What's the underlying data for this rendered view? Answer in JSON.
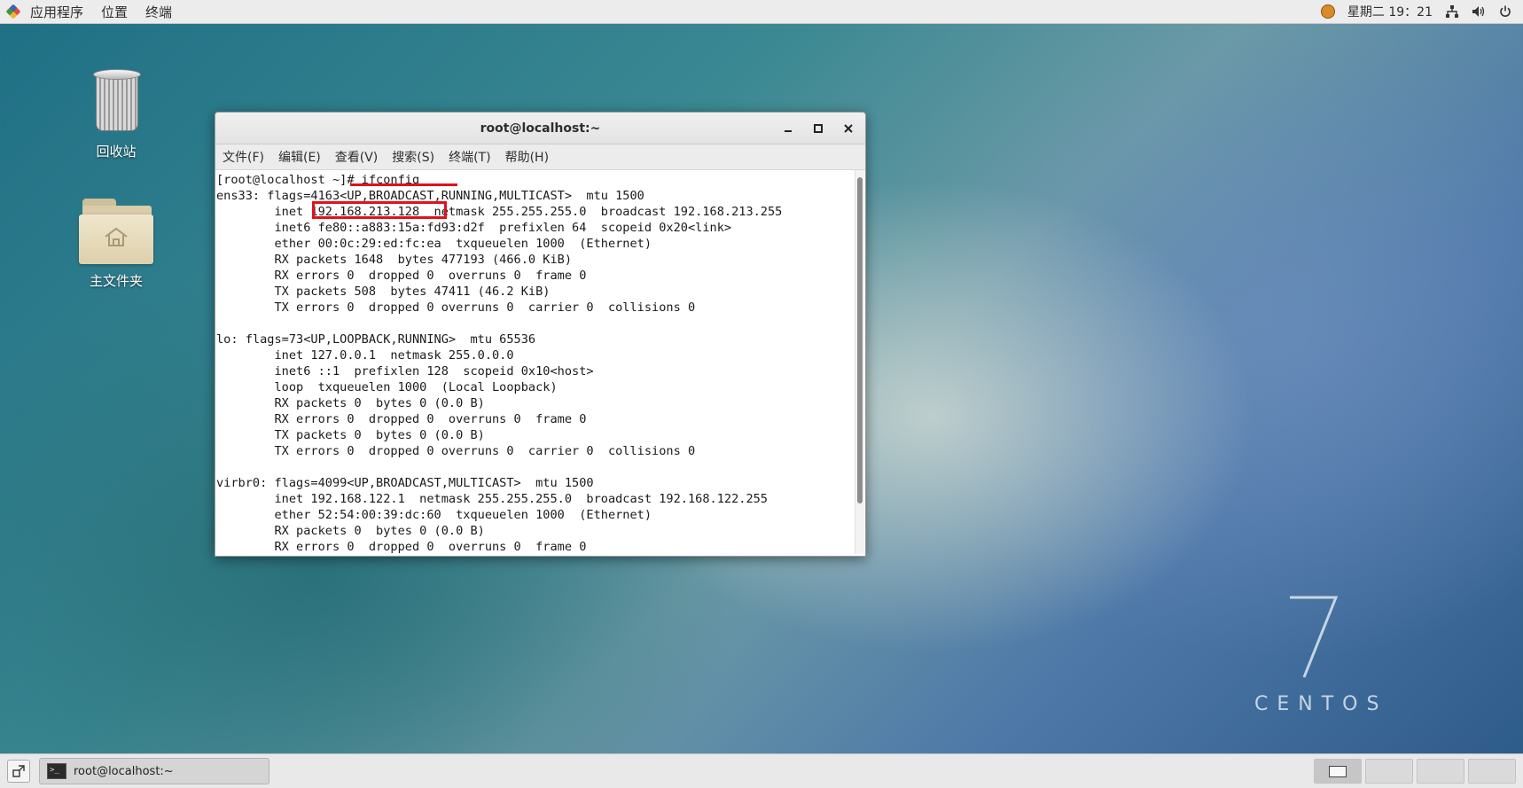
{
  "topbar": {
    "menu": [
      "应用程序",
      "位置",
      "终端"
    ],
    "clock": "星期二 19：21"
  },
  "desktop": {
    "icons": [
      {
        "label": "回收站",
        "icon": "trash-icon"
      },
      {
        "label": "主文件夹",
        "icon": "home-folder-icon"
      }
    ],
    "watermark": {
      "number": "7",
      "word": "CENTOS"
    }
  },
  "terminal": {
    "title": "root@localhost:~",
    "menu": [
      "文件(F)",
      "编辑(E)",
      "查看(V)",
      "搜索(S)",
      "终端(T)",
      "帮助(H)"
    ],
    "lines": [
      "[root@localhost ~]# ifconfig",
      "ens33: flags=4163<UP,BROADCAST,RUNNING,MULTICAST>  mtu 1500",
      "        inet 192.168.213.128  netmask 255.255.255.0  broadcast 192.168.213.255",
      "        inet6 fe80::a883:15a:fd93:d2f  prefixlen 64  scopeid 0x20<link>",
      "        ether 00:0c:29:ed:fc:ea  txqueuelen 1000  (Ethernet)",
      "        RX packets 1648  bytes 477193 (466.0 KiB)",
      "        RX errors 0  dropped 0  overruns 0  frame 0",
      "        TX packets 508  bytes 47411 (46.2 KiB)",
      "        TX errors 0  dropped 0 overruns 0  carrier 0  collisions 0",
      "",
      "lo: flags=73<UP,LOOPBACK,RUNNING>  mtu 65536",
      "        inet 127.0.0.1  netmask 255.0.0.0",
      "        inet6 ::1  prefixlen 128  scopeid 0x10<host>",
      "        loop  txqueuelen 1000  (Local Loopback)",
      "        RX packets 0  bytes 0 (0.0 B)",
      "        RX errors 0  dropped 0  overruns 0  frame 0",
      "        TX packets 0  bytes 0 (0.0 B)",
      "        TX errors 0  dropped 0 overruns 0  carrier 0  collisions 0",
      "",
      "virbr0: flags=4099<UP,BROADCAST,MULTICAST>  mtu 1500",
      "        inet 192.168.122.1  netmask 255.255.255.0  broadcast 192.168.122.255",
      "        ether 52:54:00:39:dc:60  txqueuelen 1000  (Ethernet)",
      "        RX packets 0  bytes 0 (0.0 B)",
      "        RX errors 0  dropped 0  overruns 0  frame 0"
    ],
    "annotation_color": "#e0121a"
  },
  "taskbar": {
    "task_label": "root@localhost:~",
    "workspace_count": 4
  }
}
